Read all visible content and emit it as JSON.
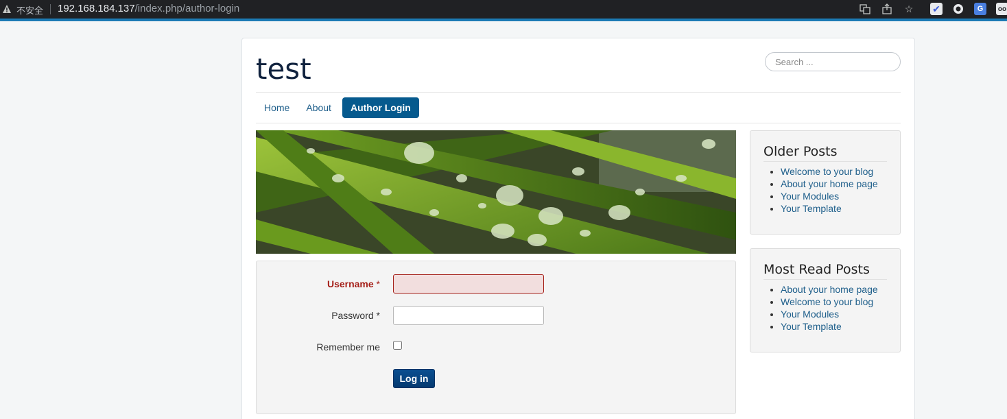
{
  "browser": {
    "security_label": "不安全",
    "url_host": "192.168.184.137",
    "url_path": "/index.php/author-login"
  },
  "site": {
    "title": "test",
    "search_placeholder": "Search ..."
  },
  "nav": {
    "items": [
      "Home",
      "About",
      "Author Login"
    ],
    "active": "Author Login"
  },
  "login": {
    "username_label": "Username",
    "password_label": "Password",
    "required_mark": "*",
    "remember_label": "Remember me",
    "submit_label": "Log in",
    "username_value": "",
    "password_value": ""
  },
  "sidebar": {
    "older": {
      "title": "Older Posts",
      "items": [
        "Welcome to your blog",
        "About your home page",
        "Your Modules",
        "Your Template"
      ]
    },
    "most_read": {
      "title": "Most Read Posts",
      "items": [
        "About your home page",
        "Welcome to your blog",
        "Your Modules",
        "Your Template"
      ]
    }
  },
  "colors": {
    "accent": "#065a8e",
    "link": "#1f5f8b",
    "error": "#a51f18",
    "banner_bg": "#2d3a1a"
  }
}
